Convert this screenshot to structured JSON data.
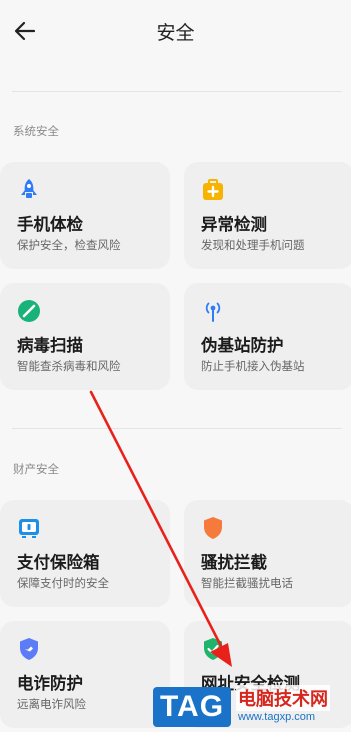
{
  "header": {
    "title": "安全",
    "back_icon": "back-arrow-icon"
  },
  "sections": [
    {
      "label": "系统安全",
      "cards": [
        {
          "title": "手机体检",
          "desc": "保护安全，检查风险",
          "icon": "rocket-icon",
          "color": "#2f7cf6"
        },
        {
          "title": "异常检测",
          "desc": "发现和处理手机问题",
          "icon": "medkit-icon",
          "color": "#f6b400"
        },
        {
          "title": "病毒扫描",
          "desc": "智能查杀病毒和风险",
          "icon": "scan-icon",
          "color": "#19b37a"
        },
        {
          "title": "伪基站防护",
          "desc": "防止手机接入伪基站",
          "icon": "antenna-icon",
          "color": "#2f7cf6"
        }
      ]
    },
    {
      "label": "财产安全",
      "cards": [
        {
          "title": "支付保险箱",
          "desc": "保障支付时的安全",
          "icon": "payment-safe-icon",
          "color": "#1e8fe6"
        },
        {
          "title": "骚扰拦截",
          "desc": "智能拦截骚扰电话",
          "icon": "shield-icon",
          "color": "#f57a3b"
        },
        {
          "title": "电诈防护",
          "desc": "远离电诈风险",
          "icon": "anti-fraud-icon",
          "color": "#5b7cf6"
        },
        {
          "title": "网址安全检测",
          "desc": "",
          "icon": "green-shield-icon",
          "color": "#1fb36b"
        }
      ]
    }
  ],
  "watermark": {
    "tag": "TAG",
    "site_name": "电脑技术网",
    "url": "www.tagxp.com"
  },
  "annotation": {
    "color": "#e8221b"
  }
}
